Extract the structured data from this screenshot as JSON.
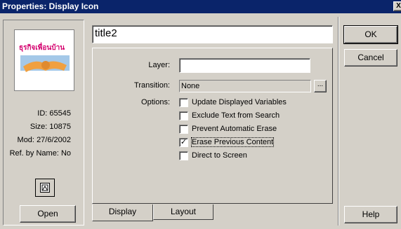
{
  "window": {
    "title": "Properties: Display Icon",
    "close_glyph": "X"
  },
  "left": {
    "preview_text": "ธุรกิจเพื่อนบ้าน",
    "info": [
      {
        "label": "ID:",
        "value": "65545"
      },
      {
        "label": "Size:",
        "value": "10875"
      },
      {
        "label": "Mod:",
        "value": "27/6/2002"
      },
      {
        "label": "Ref. by Name:",
        "value": "No"
      }
    ],
    "open_label": "Open"
  },
  "title_field": {
    "value": "title2"
  },
  "layer": {
    "label": "Layer:",
    "value": ""
  },
  "transition": {
    "label": "Transition:",
    "value": "None",
    "browse_label": "..."
  },
  "options": {
    "label": "Options:",
    "items": [
      {
        "label": "Update Displayed Variables",
        "checked": false
      },
      {
        "label": "Exclude Text from Search",
        "checked": false
      },
      {
        "label": "Prevent Automatic Erase",
        "checked": false
      },
      {
        "label": "Erase Previous Content",
        "checked": true
      },
      {
        "label": "Direct to Screen",
        "checked": false
      }
    ]
  },
  "tabs": [
    {
      "label": "Display",
      "active": true
    },
    {
      "label": "Layout",
      "active": false
    }
  ],
  "buttons": {
    "ok": "OK",
    "cancel": "Cancel",
    "help": "Help"
  },
  "colors": {
    "titlebar": "#0a246a",
    "face": "#d4d0c8"
  }
}
